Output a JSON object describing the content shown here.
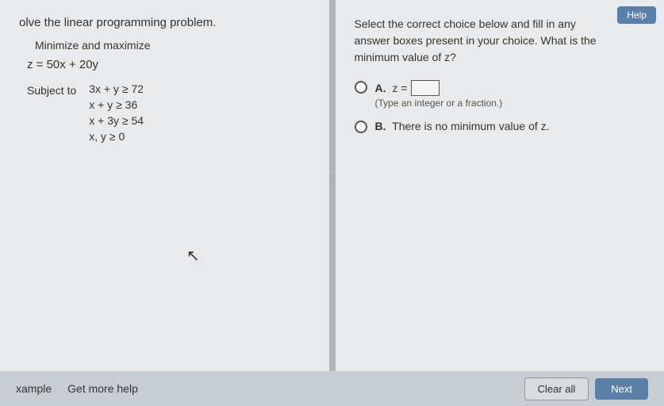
{
  "header": {
    "top_button_label": "Help"
  },
  "left": {
    "problem_title": "olve the linear programming problem.",
    "minimize_label": "Minimize and maximize",
    "objective": "z = 50x + 20y",
    "subject_to": "Subject to",
    "constraints": [
      "3x + y ≥ 72",
      "x + y ≥ 36",
      "x + 3y ≥ 54",
      "x, y ≥ 0"
    ]
  },
  "right": {
    "question_line1": "Select the correct choice below and fill in any",
    "question_line2": "answer boxes present in your choice. What is the",
    "question_line3": "minimum value of z?",
    "option_a_label": "A.",
    "option_a_text": "z =",
    "option_a_hint": "(Type an integer or a fraction.)",
    "option_b_label": "B.",
    "option_b_text": "There is no minimum value of z."
  },
  "bottom": {
    "example_link": "xample",
    "help_link": "Get more help",
    "clear_all_label": "Clear all",
    "next_label": "Next"
  },
  "divider": {
    "dots": "· · · · ·"
  }
}
